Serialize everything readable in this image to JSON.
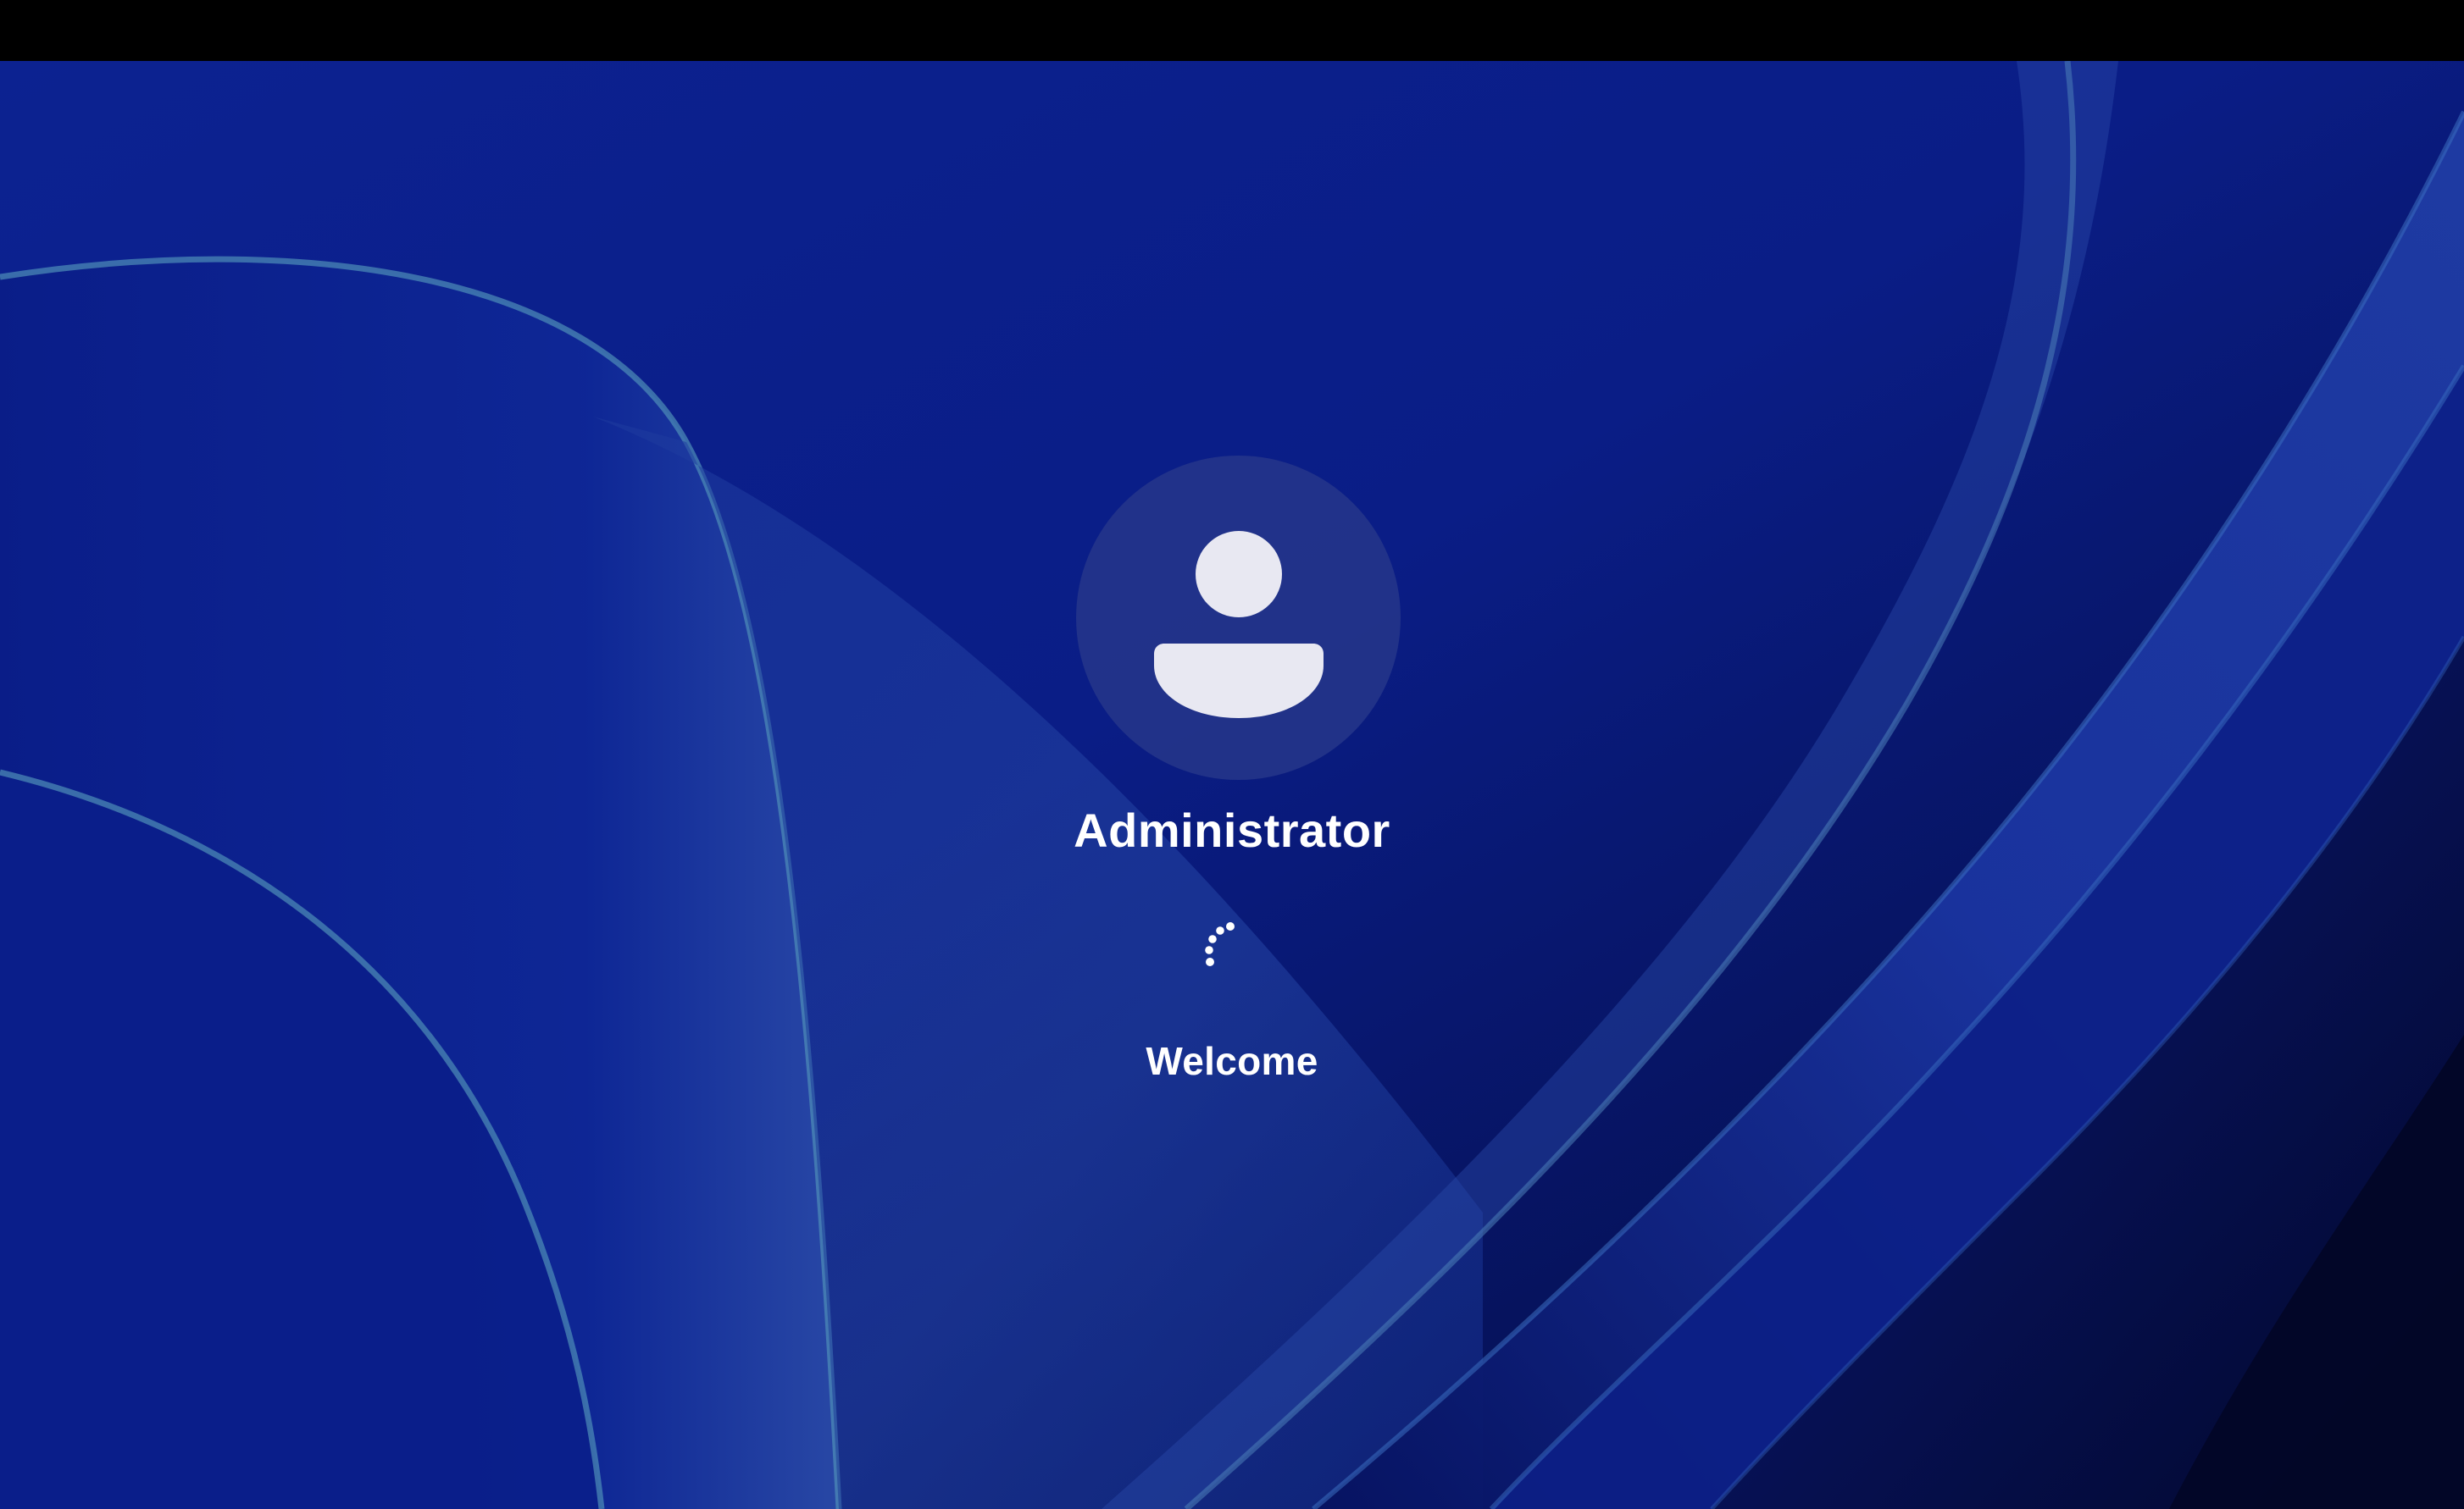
{
  "lock_screen": {
    "user_name": "Administrator",
    "status": "Welcome",
    "avatar_icon": "person-icon",
    "spinner_icon": "loading-spinner-icon"
  },
  "colors": {
    "top_bar": "#000000",
    "wallpaper_base": "#0a1f87",
    "avatar_circle": "#28388a",
    "avatar_glyph": "#e8e8f2",
    "text": "#ffffff"
  }
}
